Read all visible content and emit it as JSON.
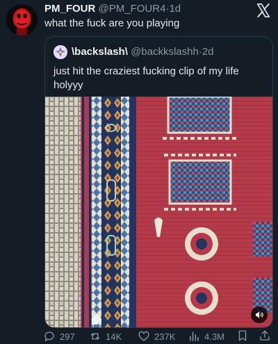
{
  "post": {
    "author": {
      "name": "PM_FOUR",
      "handle": "@PM_FOUR4",
      "separator": "·",
      "time": "1d"
    },
    "text": "what the fuck are you playing"
  },
  "quote": {
    "author": {
      "name": "\\backslash\\",
      "handle": "@backkslashh",
      "separator": "·",
      "time": "2d"
    },
    "text": "just hit the craziest fucking clip of my life holyyy"
  },
  "stats": {
    "replies": "297",
    "reposts": "14K",
    "likes": "237K",
    "views": "4.3M"
  },
  "icons": {
    "brand": "x-logo-icon",
    "reply": "reply-icon",
    "repost": "repost-icon",
    "like": "heart-icon",
    "views": "views-icon",
    "bookmark": "bookmark-icon",
    "share": "share-icon",
    "sound": "speaker-icon"
  },
  "colors": {
    "background": "#141c25",
    "muted": "#8b98a5",
    "text": "#e7e9ea",
    "border": "#2f3b47"
  }
}
